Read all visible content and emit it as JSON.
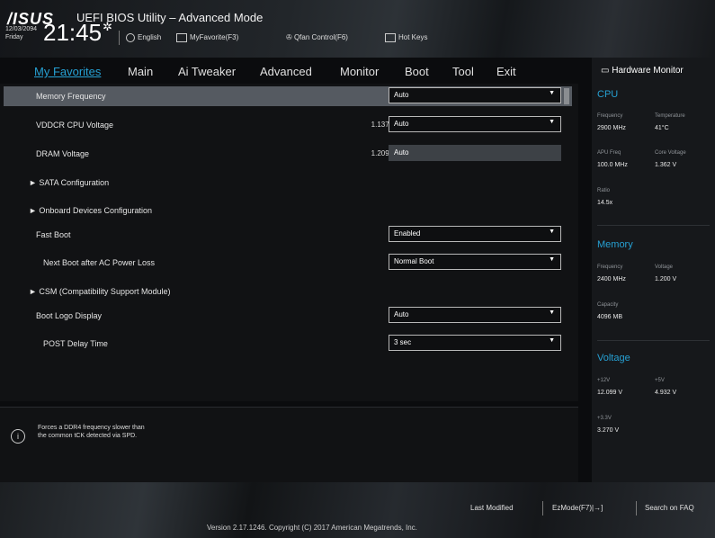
{
  "header": {
    "logo": "/ISUS",
    "title": "UEFI BIOS Utility – Advanced Mode",
    "date": "12/03/2094",
    "day": "Friday",
    "time": "21:45",
    "gear": "✲",
    "toolbar": {
      "english": "English",
      "myfavorite": "MyFavorite(F3)",
      "qfan": "Qfan Control(F6)",
      "hotkeys": "Hot Keys"
    }
  },
  "tabs": [
    "My Favorites",
    "Main",
    "Ai Tweaker",
    "Advanced",
    "Monitor",
    "Boot",
    "Tool",
    "Exit"
  ],
  "settings": [
    {
      "label": "Memory Frequency",
      "value": "",
      "dropdown": "Auto"
    },
    {
      "label": "VDDCR CPU Voltage",
      "value": "1.137V",
      "dropdown": "Auto"
    },
    {
      "label": "DRAM Voltage",
      "value": "1.209V",
      "dropdown": "Auto"
    },
    {
      "label": "SATA Configuration"
    },
    {
      "label": "Onboard Devices Configuration"
    },
    {
      "label": "Fast Boot",
      "dropdown": "Enabled"
    },
    {
      "label": "Next Boot after AC Power Loss",
      "dropdown": "Normal Boot"
    },
    {
      "label": "CSM (Compatibility Support Module)"
    },
    {
      "label": "Boot Logo Display",
      "dropdown": "Auto"
    },
    {
      "label": "POST Delay Time",
      "dropdown": "3 sec"
    }
  ],
  "help": {
    "line1": "Forces a DDR4 frequency slower than",
    "line2": "the common tCK detected via SPD."
  },
  "hardware_monitor": {
    "title": "Hardware Monitor",
    "cpu": {
      "heading": "CPU",
      "frequency_label": "Frequency",
      "frequency": "2900 MHz",
      "temperature_label": "Temperature",
      "temperature": "41°C",
      "bclk_label": "APU Freq",
      "bclk": "100.0 MHz",
      "core_voltage_label": "Core Voltage",
      "core_voltage": "1.362 V",
      "ratio_label": "Ratio",
      "ratio": "14.5x"
    },
    "memory": {
      "heading": "Memory",
      "frequency_label": "Frequency",
      "frequency": "2400 MHz",
      "voltage_label": "Voltage",
      "voltage": "1.200 V",
      "capacity_label": "Capacity",
      "capacity": "4096 MB"
    },
    "voltage": {
      "heading": "Voltage",
      "v12_label": "+12V",
      "v12": "12.099 V",
      "v5_label": "+5V",
      "v5": "4.932 V",
      "v33_label": "+3.3V",
      "v33": "3.270 V"
    }
  },
  "footer": {
    "last_modified": "Last Modified",
    "ezmode": "EzMode(F7)|→]",
    "search": "Search on FAQ",
    "version": "Version 2.17.1246. Copyright (C) 2017 American Megatrends, Inc."
  },
  "colors": {
    "accent": "#26a0d3",
    "highlight_row": "#555a61"
  }
}
